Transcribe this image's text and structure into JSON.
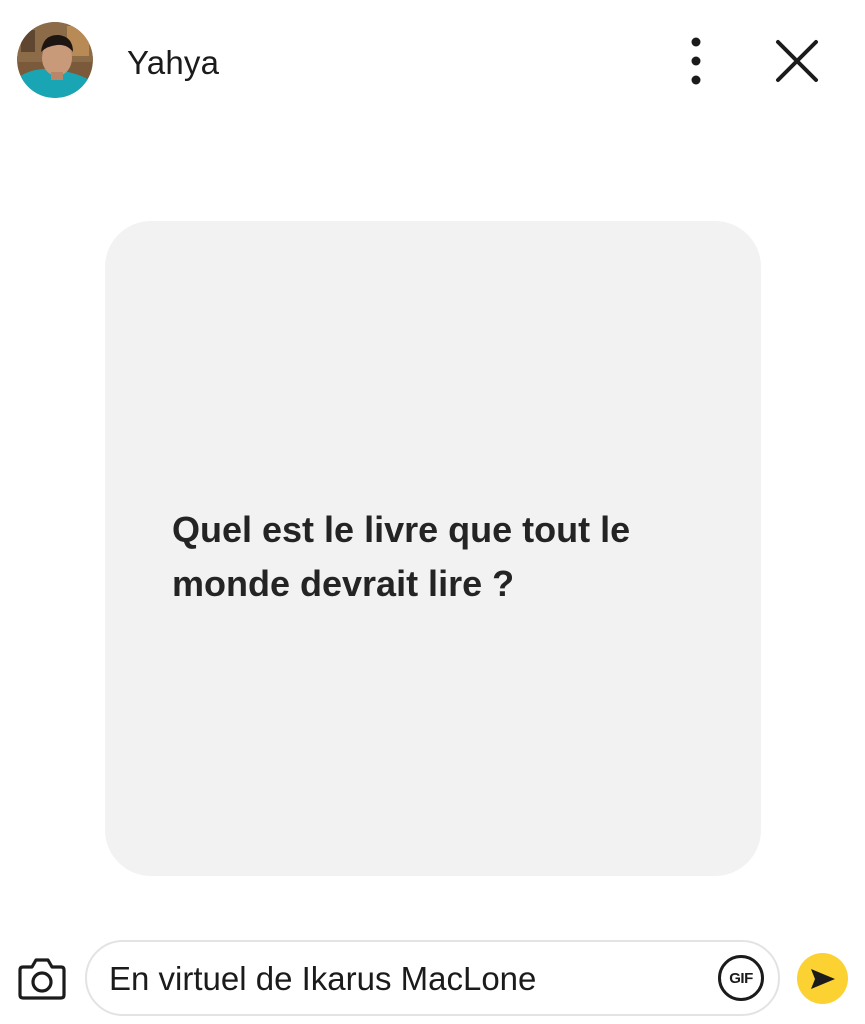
{
  "header": {
    "username": "Yahya",
    "avatar_icon": "user-avatar-photo",
    "more_icon": "more-vertical-icon",
    "close_icon": "close-icon"
  },
  "card": {
    "question": "Quel est le livre que tout le monde devrait lire ?",
    "background": "#f2f2f2"
  },
  "composer": {
    "camera_icon": "camera-icon",
    "message_value": "En virtuel de Ikarus MacLone",
    "gif_label": "GIF",
    "send_icon": "send-arrow-icon",
    "send_color": "#fbd232"
  }
}
